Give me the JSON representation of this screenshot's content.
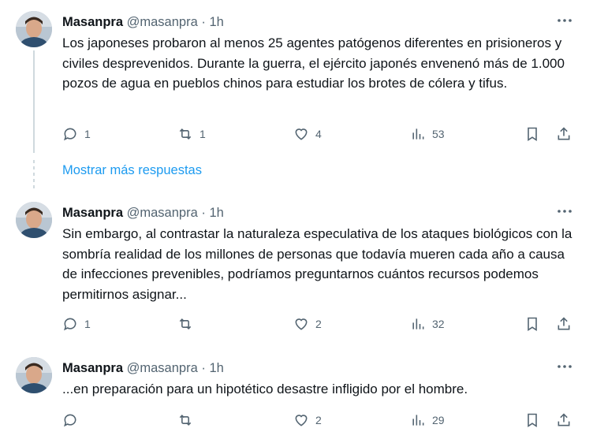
{
  "tweets": [
    {
      "name": "Masanpra",
      "handle": "@masanpra",
      "sep": "·",
      "time": "1h",
      "text": "Los japoneses probaron al menos 25 agentes patógenos diferentes en prisioneros y civiles desprevenidos. Durante la guerra, el ejército japonés envenenó más de 1.000 pozos de agua en pueblos chinos para estudiar los brotes de cólera y tifus.",
      "replies": "1",
      "retweets": "1",
      "likes": "4",
      "views": "53"
    },
    {
      "name": "Masanpra",
      "handle": "@masanpra",
      "sep": "·",
      "time": "1h",
      "text": "Sin embargo, al contrastar la naturaleza especulativa de los ataques biológicos con la sombría realidad de los millones de personas que todavía mueren cada año a causa de infecciones prevenibles, podríamos preguntarnos cuántos recursos podemos permitirnos asignar...",
      "replies": "1",
      "retweets": "",
      "likes": "2",
      "views": "32"
    },
    {
      "name": "Masanpra",
      "handle": "@masanpra",
      "sep": "·",
      "time": "1h",
      "text": "...en preparación para un hipotético desastre infligido por el hombre.",
      "replies": "",
      "retweets": "",
      "likes": "2",
      "views": "29"
    }
  ],
  "show_more": "Mostrar más respuestas",
  "icons": {
    "reply": "reply-icon",
    "retweet": "retweet-icon",
    "like": "heart-icon",
    "views": "views-icon",
    "bookmark": "bookmark-icon",
    "share": "share-icon",
    "more": "more-icon"
  },
  "colors": {
    "link": "#1d9bf0",
    "muted": "#536471",
    "text": "#0f1419"
  }
}
